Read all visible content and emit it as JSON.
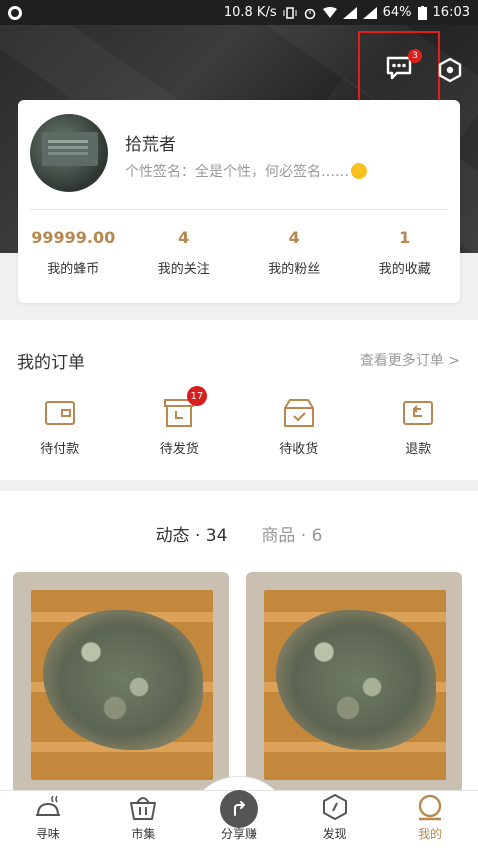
{
  "status_bar": {
    "speed": "10.8 K/s",
    "battery": "64%",
    "time": "16:03"
  },
  "header": {
    "message_badge": "3"
  },
  "profile": {
    "nickname": "拾荒者",
    "signature": "个性签名：全是个性，何必签名……",
    "stats": [
      {
        "value": "99999.00",
        "label": "我的蜂币"
      },
      {
        "value": "4",
        "label": "我的关注"
      },
      {
        "value": "4",
        "label": "我的粉丝"
      },
      {
        "value": "1",
        "label": "我的收藏"
      }
    ]
  },
  "orders": {
    "title": "我的订单",
    "more": "查看更多订单 >",
    "items": [
      {
        "label": "待付款",
        "icon": "wallet-icon"
      },
      {
        "label": "待发货",
        "icon": "box-clock-icon",
        "badge": "17"
      },
      {
        "label": "待收货",
        "icon": "package-check-icon"
      },
      {
        "label": "退款",
        "icon": "refund-icon"
      }
    ]
  },
  "feed": {
    "tabs": [
      {
        "label": "动态 · 34",
        "active": true
      },
      {
        "label": "商品 · 6",
        "active": false
      }
    ]
  },
  "tabbar": {
    "items": [
      {
        "label": "寻味",
        "icon": "dish-icon"
      },
      {
        "label": "市集",
        "icon": "basket-icon"
      },
      {
        "label": "分享赚",
        "icon": "share-arrow-icon"
      },
      {
        "label": "发现",
        "icon": "hexagon-icon"
      },
      {
        "label": "我的",
        "icon": "profile-icon",
        "active": true
      }
    ]
  },
  "colors": {
    "accent": "#b8884e",
    "badge": "#d81e1e",
    "highlight_box": "#e0201c"
  }
}
